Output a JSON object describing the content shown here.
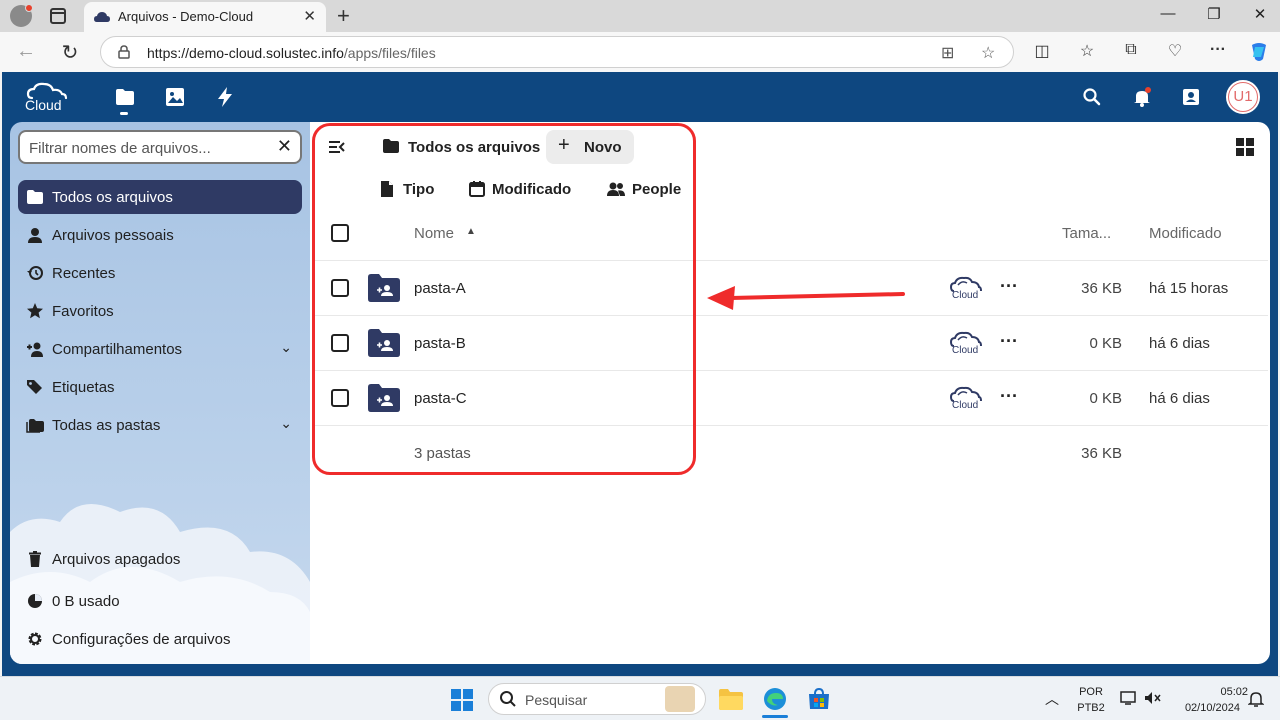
{
  "browser": {
    "tab_title": "Arquivos - Demo-Cloud",
    "url_host": "https://demo-cloud.solustec.info",
    "url_path": "/apps/files/files",
    "new_tab": "+",
    "close_tab": "✕",
    "window_min": "—",
    "window_max": "❐",
    "window_close": "✕",
    "more_menu": "···"
  },
  "app": {
    "logo": "Cloud",
    "avatar_initials": "U1"
  },
  "sidebar": {
    "filter_placeholder": "Filtrar nomes de arquivos...",
    "items": [
      {
        "label": "Todos os arquivos",
        "icon": "folder-icon"
      },
      {
        "label": "Arquivos pessoais",
        "icon": "person-icon"
      },
      {
        "label": "Recentes",
        "icon": "history-icon"
      },
      {
        "label": "Favoritos",
        "icon": "star-icon"
      },
      {
        "label": "Compartilhamentos",
        "icon": "share-icon"
      },
      {
        "label": "Etiquetas",
        "icon": "tag-icon"
      },
      {
        "label": "Todas as pastas",
        "icon": "folders-icon"
      }
    ],
    "bottom": [
      {
        "label": "Arquivos apagados",
        "icon": "trash-icon"
      },
      {
        "label": "0 B usado",
        "icon": "pie-chart-icon"
      },
      {
        "label": "Configurações de arquivos",
        "icon": "gear-icon"
      }
    ]
  },
  "toolbar": {
    "breadcrumb": "Todos os arquivos",
    "new_button": "Novo",
    "filter_type": "Tipo",
    "filter_modified": "Modificado",
    "filter_people": "People"
  },
  "table": {
    "col_name": "Nome",
    "col_size": "Tama...",
    "col_modified": "Modificado",
    "rows": [
      {
        "name": "pasta-A",
        "size": "36 KB",
        "modified": "há 15 horas"
      },
      {
        "name": "pasta-B",
        "size": "0 KB",
        "modified": "há 6 dias"
      },
      {
        "name": "pasta-C",
        "size": "0 KB",
        "modified": "há 6 dias"
      }
    ],
    "summary_count": "3 pastas",
    "summary_size": "36 KB"
  },
  "taskbar": {
    "search_placeholder": "Pesquisar",
    "lang_top": "POR",
    "lang_bottom": "PTB2",
    "time": "05:02",
    "date": "02/10/2024"
  },
  "colors": {
    "header_bg": "#0e4780",
    "active_nav": "#2f3a64",
    "highlight": "#ef2b2b"
  }
}
